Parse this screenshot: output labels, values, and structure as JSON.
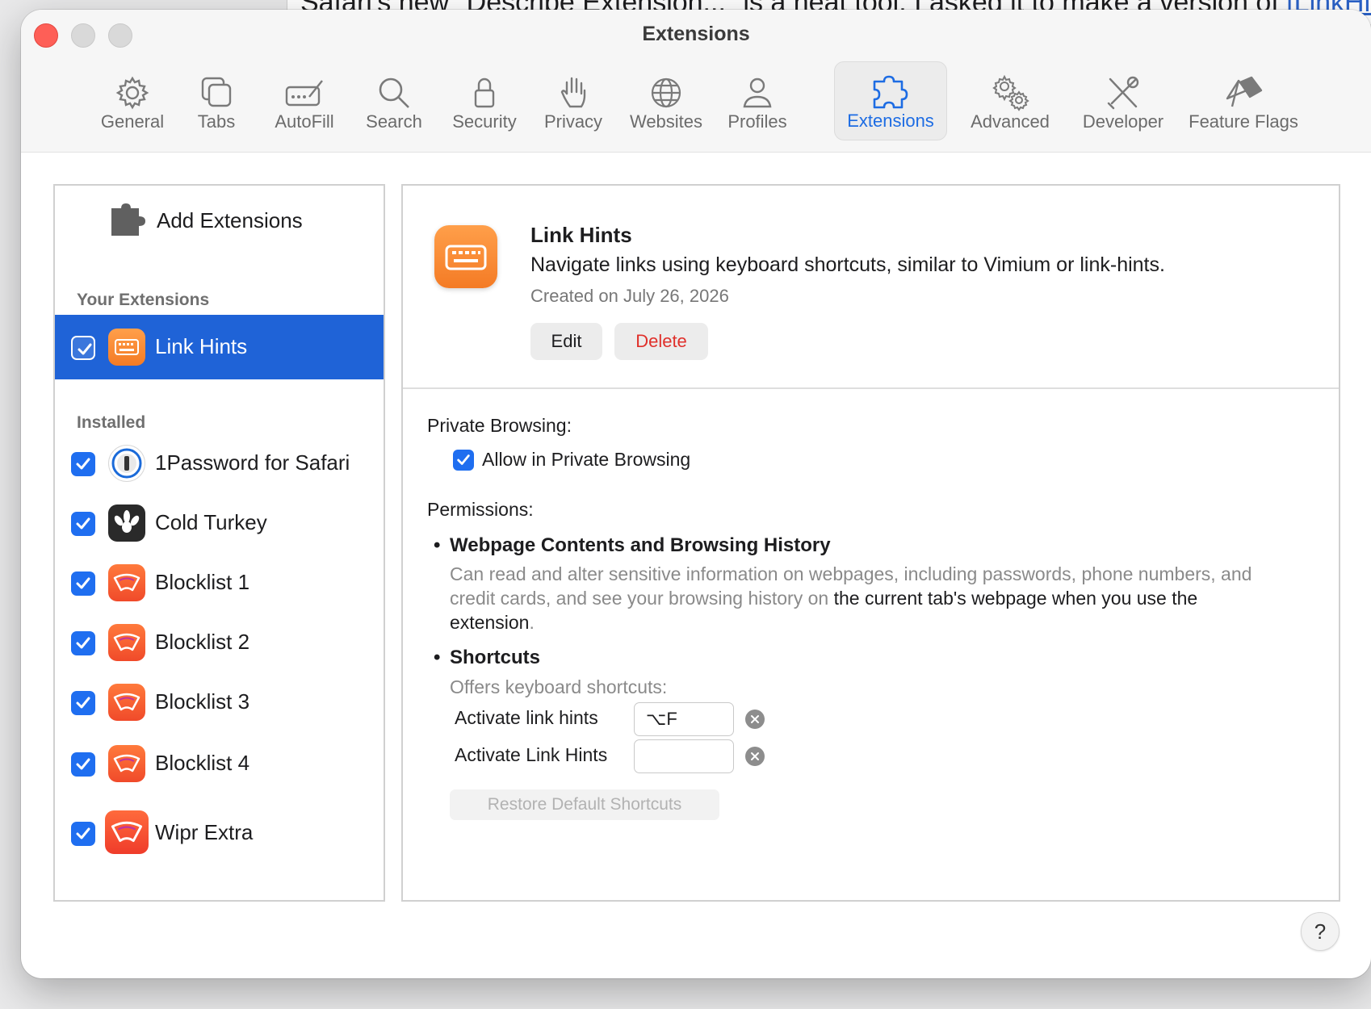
{
  "background_document": {
    "text_prefix": "Safari's new \"Describe Extension...\" is a neat tool. I asked it to make a version of ",
    "link_text": "[LinkHints]"
  },
  "window": {
    "title": "Extensions"
  },
  "toolbar": {
    "items": [
      {
        "label": "General",
        "icon": "gear-icon"
      },
      {
        "label": "Tabs",
        "icon": "tabs-icon"
      },
      {
        "label": "AutoFill",
        "icon": "autofill-icon"
      },
      {
        "label": "Search",
        "icon": "search-icon"
      },
      {
        "label": "Security",
        "icon": "lock-icon"
      },
      {
        "label": "Privacy",
        "icon": "hand-icon"
      },
      {
        "label": "Websites",
        "icon": "globe-icon"
      },
      {
        "label": "Profiles",
        "icon": "person-icon"
      },
      {
        "label": "Extensions",
        "icon": "puzzle-icon"
      },
      {
        "label": "Advanced",
        "icon": "gears-icon"
      },
      {
        "label": "Developer",
        "icon": "tools-icon"
      },
      {
        "label": "Feature Flags",
        "icon": "flags-icon"
      }
    ],
    "active": "Extensions"
  },
  "sidebar": {
    "add_extensions_label": "Add Extensions",
    "your_extensions_header": "Your Extensions",
    "your_extensions": [
      {
        "name": "Link Hints",
        "checked": true,
        "selected": true
      }
    ],
    "installed_header": "Installed",
    "installed": [
      {
        "name": "1Password for Safari",
        "checked": true
      },
      {
        "name": "Cold Turkey",
        "checked": true
      },
      {
        "name": "Blocklist 1",
        "checked": true
      },
      {
        "name": "Blocklist 2",
        "checked": true
      },
      {
        "name": "Blocklist 3",
        "checked": true
      },
      {
        "name": "Blocklist 4",
        "checked": true
      },
      {
        "name": "Wipr Extra",
        "checked": true
      }
    ]
  },
  "detail": {
    "name": "Link Hints",
    "description": "Navigate links using keyboard shortcuts, similar to Vimium or link-hints.",
    "created": "Created on July 26, 2026",
    "edit_label": "Edit",
    "delete_label": "Delete",
    "private_browsing_label": "Private Browsing:",
    "allow_private_label": "Allow in Private Browsing",
    "allow_private_checked": true,
    "permissions_label": "Permissions:",
    "permission_webpage": {
      "title": "Webpage Contents and Browsing History",
      "body_part1": "Can read and alter sensitive information on webpages, including passwords, phone numbers, and credit cards, and see your browsing history on ",
      "body_highlight": "the current tab's webpage when you use the extension",
      "body_end": "."
    },
    "permission_shortcuts": {
      "title": "Shortcuts",
      "body": "Offers keyboard shortcuts:"
    },
    "shortcuts": [
      {
        "label": "Activate link hints",
        "value": "⌥F"
      },
      {
        "label": "Activate Link Hints",
        "value": ""
      }
    ],
    "restore_label": "Restore Default Shortcuts"
  },
  "help_label": "?",
  "colors": {
    "accent": "#1d6ce3",
    "selection": "#1f63d7",
    "delete": "#e0302b",
    "close": "#fe5f57"
  }
}
